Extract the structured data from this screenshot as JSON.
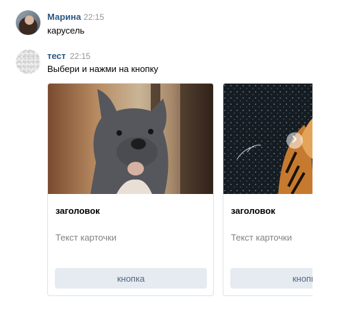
{
  "messages": [
    {
      "author": "Марина",
      "time": "22:15",
      "text": "карусель"
    },
    {
      "author": "тест",
      "time": "22:15",
      "text": "Выбери и нажми на кнопку"
    }
  ],
  "carousel": {
    "cards": [
      {
        "image": "french-bulldog-photo",
        "title": "заголовок",
        "text": "Текст карточки",
        "button": "кнопка"
      },
      {
        "image": "tiger-shaking-water-photo",
        "title": "заголовок",
        "text": "Текст карточки",
        "button": "кнопка"
      }
    ],
    "next_icon": "chevron-right-icon"
  },
  "colors": {
    "author": "#2a5885",
    "time": "#939393",
    "card_button_bg": "#e5ebf1",
    "card_button_text": "#55677d"
  }
}
